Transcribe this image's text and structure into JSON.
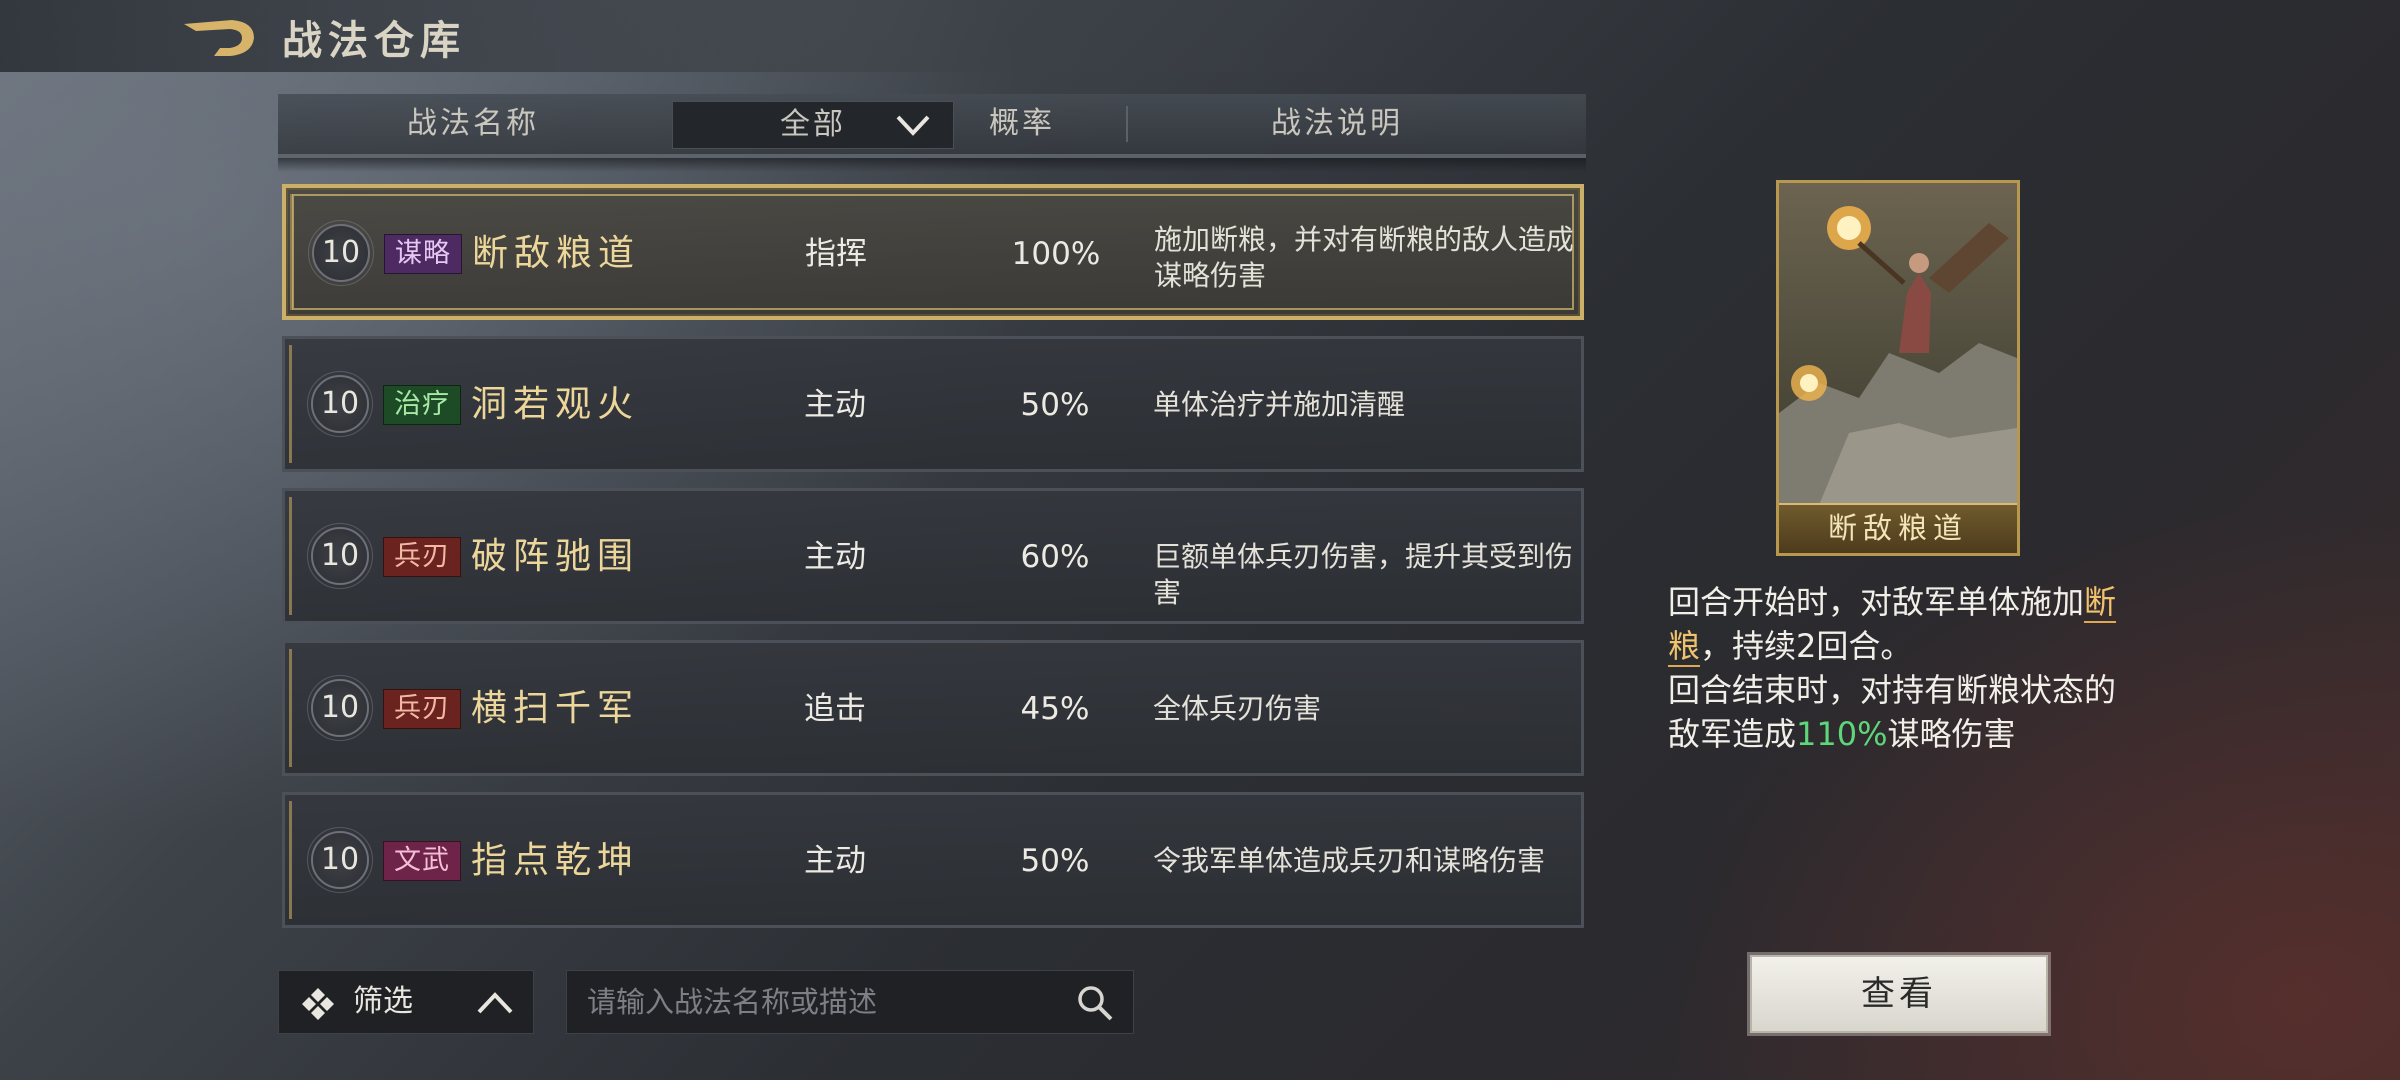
{
  "page": {
    "title": "战法仓库"
  },
  "header": {
    "col_name": "战法名称",
    "filter_selected": "全部",
    "col_rate": "概率",
    "col_desc": "战法说明"
  },
  "skills": [
    {
      "level": "10",
      "type": "谋略",
      "type_color": "#4e2a63",
      "name": "断敌粮道",
      "kind": "指挥",
      "rate": "100%",
      "desc": "施加断粮，并对有断粮的敌人造成谋略伤害",
      "selected": true
    },
    {
      "level": "10",
      "type": "治疗",
      "type_color": "#1c4b26",
      "name": "洞若观火",
      "kind": "主动",
      "rate": "50%",
      "desc": "单体治疗并施加清醒",
      "selected": false
    },
    {
      "level": "10",
      "type": "兵刃",
      "type_color": "#6a231f",
      "name": "破阵驰围",
      "kind": "主动",
      "rate": "60%",
      "desc": "巨额单体兵刃伤害，提升其受到伤害",
      "selected": false
    },
    {
      "level": "10",
      "type": "兵刃",
      "type_color": "#6a231f",
      "name": "横扫千军",
      "kind": "追击",
      "rate": "45%",
      "desc": "全体兵刃伤害",
      "selected": false
    },
    {
      "level": "10",
      "type": "文武",
      "type_color": "#6e2448",
      "name": "指点乾坤",
      "kind": "主动",
      "rate": "50%",
      "desc": "令我军单体造成兵刃和谋略伤害",
      "selected": false
    }
  ],
  "bottom": {
    "filter_label": "筛选",
    "search_placeholder": "请输入战法名称或描述"
  },
  "detail": {
    "card_name": "断敌粮道",
    "line1_pre": "回合开始时，对敌军单体施加",
    "line1_hl": "断粮",
    "line1_post": "，持续2回合。",
    "line2_pre": "回合结束时，对持有断粮状态的敌军造成",
    "line2_hl": "110%",
    "line2_post": "谋略伤害",
    "view_button": "查看"
  },
  "icons": {
    "back": "back-arrow-icon",
    "dropdown": "chevron-down-icon",
    "filter": "diamond-filter-icon",
    "expand": "chevron-up-icon",
    "search": "search-icon"
  }
}
